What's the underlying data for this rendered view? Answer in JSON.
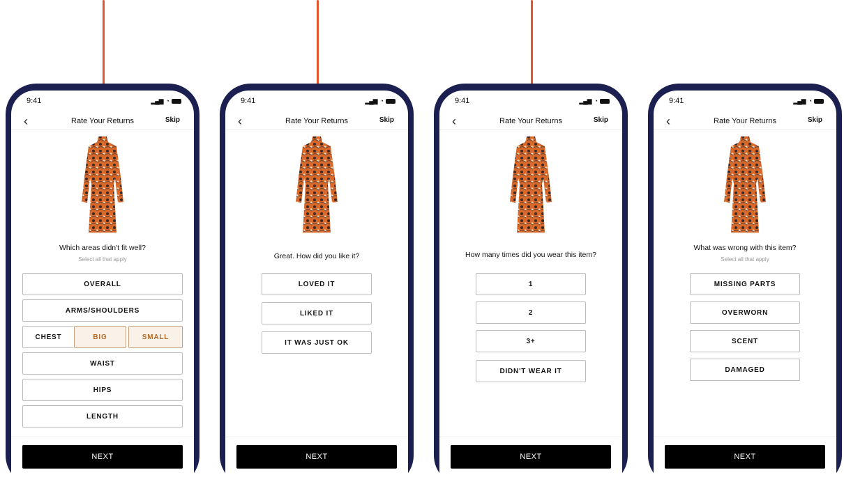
{
  "screens": [
    {
      "status_time": "9:41",
      "title": "Rate Your Returns",
      "skip": "Skip",
      "question": "Which areas didn't fit well?",
      "subtitle": "Select all that apply",
      "options": [
        "OVERALL",
        "ARMS/SHOULDERS",
        "WAIST",
        "HIPS",
        "LENGTH"
      ],
      "chest_row": {
        "label": "CHEST",
        "big": "BIG",
        "small": "SMALL",
        "selected": [
          "BIG",
          "SMALL"
        ]
      },
      "next": "NEXT"
    },
    {
      "status_time": "9:41",
      "title": "Rate Your Returns",
      "skip": "Skip",
      "question": "Great. How did you like it?",
      "options": [
        "LOVED IT",
        "LIKED IT",
        "IT WAS JUST OK"
      ],
      "next": "NEXT"
    },
    {
      "status_time": "9:41",
      "title": "Rate Your Returns",
      "skip": "Skip",
      "question": "How many times did you wear this item?",
      "options": [
        "1",
        "2",
        "3+",
        "DIDN'T WEAR IT"
      ],
      "next": "NEXT"
    },
    {
      "status_time": "9:41",
      "title": "Rate Your Returns",
      "skip": "Skip",
      "question": "What was wrong with this item?",
      "subtitle": "Select all that apply",
      "options": [
        "MISSING PARTS",
        "OVERWORN",
        "SCENT",
        "DAMAGED"
      ],
      "next": "NEXT"
    }
  ],
  "icons": {
    "back": "chevron-left-icon",
    "signal": "signal-icon",
    "wifi": "wifi-icon",
    "battery": "battery-icon"
  },
  "colors": {
    "pointer": "#e2562a",
    "phone_frame": "#1c2050",
    "selected_bg": "#faf2e8",
    "selected_text": "#b06a2a",
    "button": "#000000"
  }
}
